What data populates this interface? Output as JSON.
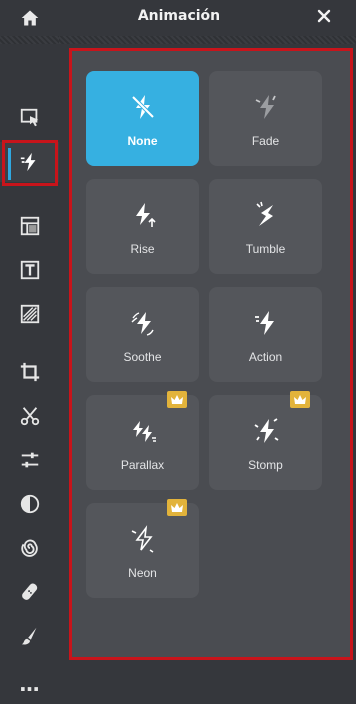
{
  "panel": {
    "title": "Animación",
    "close_label": "✕"
  },
  "rail": {
    "items": [
      {
        "name": "home-icon"
      },
      {
        "name": "select-icon"
      },
      {
        "name": "animation-icon",
        "active": true
      },
      {
        "name": "layout-icon"
      },
      {
        "name": "text-icon"
      },
      {
        "name": "texture-icon"
      },
      {
        "name": "crop-icon"
      },
      {
        "name": "cut-icon"
      },
      {
        "name": "adjust-icon"
      },
      {
        "name": "contrast-icon"
      },
      {
        "name": "spiral-icon"
      },
      {
        "name": "bandage-icon"
      },
      {
        "name": "brush-icon"
      },
      {
        "name": "more-icon",
        "label": "…"
      }
    ]
  },
  "animations": [
    {
      "label": "None",
      "selected": true,
      "premium": false
    },
    {
      "label": "Fade",
      "selected": false,
      "premium": false
    },
    {
      "label": "Rise",
      "selected": false,
      "premium": false
    },
    {
      "label": "Tumble",
      "selected": false,
      "premium": false
    },
    {
      "label": "Soothe",
      "selected": false,
      "premium": false
    },
    {
      "label": "Action",
      "selected": false,
      "premium": false
    },
    {
      "label": "Parallax",
      "selected": false,
      "premium": true
    },
    {
      "label": "Stomp",
      "selected": false,
      "premium": true
    },
    {
      "label": "Neon",
      "selected": false,
      "premium": true
    }
  ],
  "colors": {
    "accent": "#36b0e1",
    "highlight": "#c8141b",
    "premium": "#e2b33b"
  }
}
